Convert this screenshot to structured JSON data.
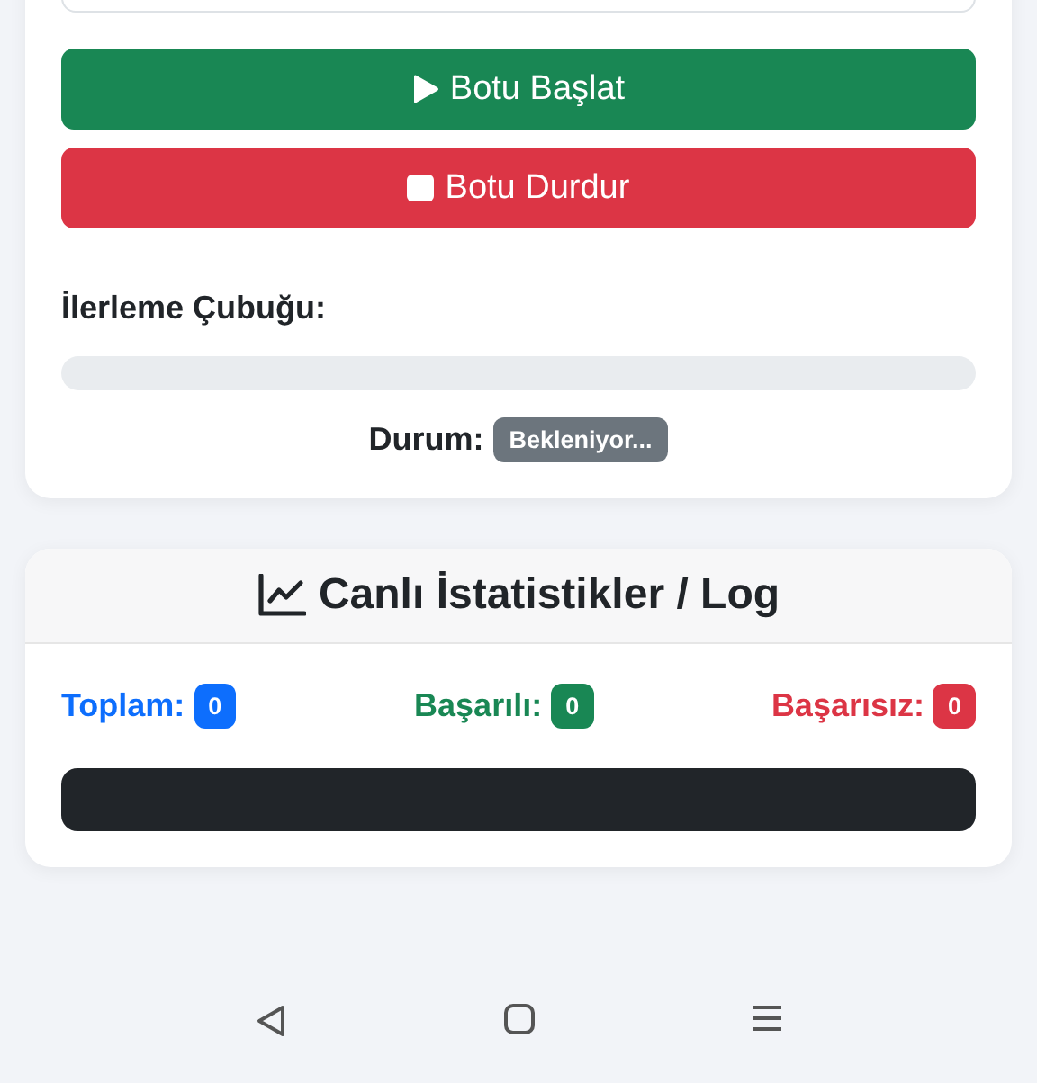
{
  "control": {
    "buttons": [
      {
        "kind": "start",
        "label": "Botu Başlat"
      },
      {
        "kind": "stop",
        "label": "Botu Durdur"
      }
    ],
    "progress": {
      "label": "İlerleme Çubuğu:",
      "level": 0
    },
    "status": {
      "label": "Durum:",
      "value": "Bekleniyor..."
    }
  },
  "stats": {
    "title": "Canlı İstatistikler / Log",
    "counters": [
      {
        "label": "Toplam:",
        "value": "0",
        "color": "#0d6efd"
      },
      {
        "label": "Başarılı:",
        "value": "0",
        "color": "#198754"
      },
      {
        "label": "Başarısız:",
        "value": "0",
        "color": "#dc3545"
      }
    ]
  }
}
